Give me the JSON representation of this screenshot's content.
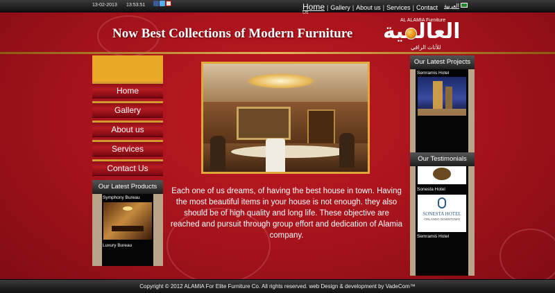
{
  "topbar": {
    "date": "13-02-2013",
    "time": "13:53:51",
    "social_icons": [
      "facebook-icon",
      "twitter-icon",
      "youtube-icon"
    ],
    "nav": [
      "Home",
      "Gallery",
      "About us",
      "Services",
      "Contact"
    ],
    "nav_overflow": "Us",
    "arabic_link": "العربية"
  },
  "header": {
    "tagline": "Now Best Collections of Modern Furniture",
    "logo_ar": "العالمية",
    "logo_en": "AL ALAMIA Furniture",
    "logo_ar_sub": "للأثاث الراقي"
  },
  "sidebar": {
    "menu": [
      "Home",
      "Gallery",
      "About us",
      "Services",
      "Contact Us"
    ],
    "products_title": "Our Latest Products",
    "products": [
      "Symphony Bureau",
      "Luxury Bureau"
    ]
  },
  "main": {
    "intro": "Each one of us dreams, of having the best house in town. Having the most beautiful items in your house is not enough. they also should be of high quality and long life. These objective are reached and pursuit through group effort and dedication of Alamia company."
  },
  "rightbar": {
    "projects_title": "Our Latest Projects",
    "projects": [
      "Semramis Hotel"
    ],
    "testimonials_title": "Our  Testimonials",
    "testimonials": [
      "Sonesta Hotel",
      "Semramis Hotel"
    ],
    "sonesta_logo": "SONESTA HOTEL",
    "sonesta_sub": "ORLANDO DOWNTOWN"
  },
  "footer": {
    "copyright": "Copyright © 2012 ALAMIA For Elite Furniture Co. All rights reserved. web Design & development by VadeCom™"
  },
  "colors": {
    "brand_red": "#b0161f",
    "accent_gold": "#e9a825",
    "bar_dark": "#1e1e1e"
  }
}
